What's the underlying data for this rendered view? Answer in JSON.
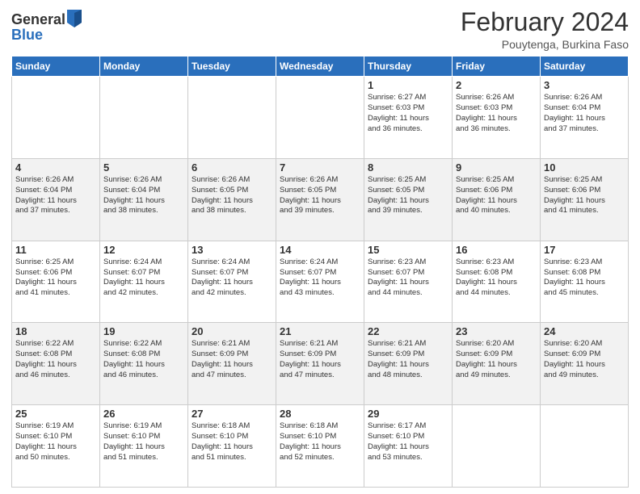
{
  "header": {
    "logo_general": "General",
    "logo_blue": "Blue",
    "title": "February 2024",
    "subtitle": "Pouytenga, Burkina Faso"
  },
  "weekdays": [
    "Sunday",
    "Monday",
    "Tuesday",
    "Wednesday",
    "Thursday",
    "Friday",
    "Saturday"
  ],
  "weeks": [
    [
      {
        "day": "",
        "info": ""
      },
      {
        "day": "",
        "info": ""
      },
      {
        "day": "",
        "info": ""
      },
      {
        "day": "",
        "info": ""
      },
      {
        "day": "1",
        "info": "Sunrise: 6:27 AM\nSunset: 6:03 PM\nDaylight: 11 hours\nand 36 minutes."
      },
      {
        "day": "2",
        "info": "Sunrise: 6:26 AM\nSunset: 6:03 PM\nDaylight: 11 hours\nand 36 minutes."
      },
      {
        "day": "3",
        "info": "Sunrise: 6:26 AM\nSunset: 6:04 PM\nDaylight: 11 hours\nand 37 minutes."
      }
    ],
    [
      {
        "day": "4",
        "info": "Sunrise: 6:26 AM\nSunset: 6:04 PM\nDaylight: 11 hours\nand 37 minutes."
      },
      {
        "day": "5",
        "info": "Sunrise: 6:26 AM\nSunset: 6:04 PM\nDaylight: 11 hours\nand 38 minutes."
      },
      {
        "day": "6",
        "info": "Sunrise: 6:26 AM\nSunset: 6:05 PM\nDaylight: 11 hours\nand 38 minutes."
      },
      {
        "day": "7",
        "info": "Sunrise: 6:26 AM\nSunset: 6:05 PM\nDaylight: 11 hours\nand 39 minutes."
      },
      {
        "day": "8",
        "info": "Sunrise: 6:25 AM\nSunset: 6:05 PM\nDaylight: 11 hours\nand 39 minutes."
      },
      {
        "day": "9",
        "info": "Sunrise: 6:25 AM\nSunset: 6:06 PM\nDaylight: 11 hours\nand 40 minutes."
      },
      {
        "day": "10",
        "info": "Sunrise: 6:25 AM\nSunset: 6:06 PM\nDaylight: 11 hours\nand 41 minutes."
      }
    ],
    [
      {
        "day": "11",
        "info": "Sunrise: 6:25 AM\nSunset: 6:06 PM\nDaylight: 11 hours\nand 41 minutes."
      },
      {
        "day": "12",
        "info": "Sunrise: 6:24 AM\nSunset: 6:07 PM\nDaylight: 11 hours\nand 42 minutes."
      },
      {
        "day": "13",
        "info": "Sunrise: 6:24 AM\nSunset: 6:07 PM\nDaylight: 11 hours\nand 42 minutes."
      },
      {
        "day": "14",
        "info": "Sunrise: 6:24 AM\nSunset: 6:07 PM\nDaylight: 11 hours\nand 43 minutes."
      },
      {
        "day": "15",
        "info": "Sunrise: 6:23 AM\nSunset: 6:07 PM\nDaylight: 11 hours\nand 44 minutes."
      },
      {
        "day": "16",
        "info": "Sunrise: 6:23 AM\nSunset: 6:08 PM\nDaylight: 11 hours\nand 44 minutes."
      },
      {
        "day": "17",
        "info": "Sunrise: 6:23 AM\nSunset: 6:08 PM\nDaylight: 11 hours\nand 45 minutes."
      }
    ],
    [
      {
        "day": "18",
        "info": "Sunrise: 6:22 AM\nSunset: 6:08 PM\nDaylight: 11 hours\nand 46 minutes."
      },
      {
        "day": "19",
        "info": "Sunrise: 6:22 AM\nSunset: 6:08 PM\nDaylight: 11 hours\nand 46 minutes."
      },
      {
        "day": "20",
        "info": "Sunrise: 6:21 AM\nSunset: 6:09 PM\nDaylight: 11 hours\nand 47 minutes."
      },
      {
        "day": "21",
        "info": "Sunrise: 6:21 AM\nSunset: 6:09 PM\nDaylight: 11 hours\nand 47 minutes."
      },
      {
        "day": "22",
        "info": "Sunrise: 6:21 AM\nSunset: 6:09 PM\nDaylight: 11 hours\nand 48 minutes."
      },
      {
        "day": "23",
        "info": "Sunrise: 6:20 AM\nSunset: 6:09 PM\nDaylight: 11 hours\nand 49 minutes."
      },
      {
        "day": "24",
        "info": "Sunrise: 6:20 AM\nSunset: 6:09 PM\nDaylight: 11 hours\nand 49 minutes."
      }
    ],
    [
      {
        "day": "25",
        "info": "Sunrise: 6:19 AM\nSunset: 6:10 PM\nDaylight: 11 hours\nand 50 minutes."
      },
      {
        "day": "26",
        "info": "Sunrise: 6:19 AM\nSunset: 6:10 PM\nDaylight: 11 hours\nand 51 minutes."
      },
      {
        "day": "27",
        "info": "Sunrise: 6:18 AM\nSunset: 6:10 PM\nDaylight: 11 hours\nand 51 minutes."
      },
      {
        "day": "28",
        "info": "Sunrise: 6:18 AM\nSunset: 6:10 PM\nDaylight: 11 hours\nand 52 minutes."
      },
      {
        "day": "29",
        "info": "Sunrise: 6:17 AM\nSunset: 6:10 PM\nDaylight: 11 hours\nand 53 minutes."
      },
      {
        "day": "",
        "info": ""
      },
      {
        "day": "",
        "info": ""
      }
    ]
  ]
}
